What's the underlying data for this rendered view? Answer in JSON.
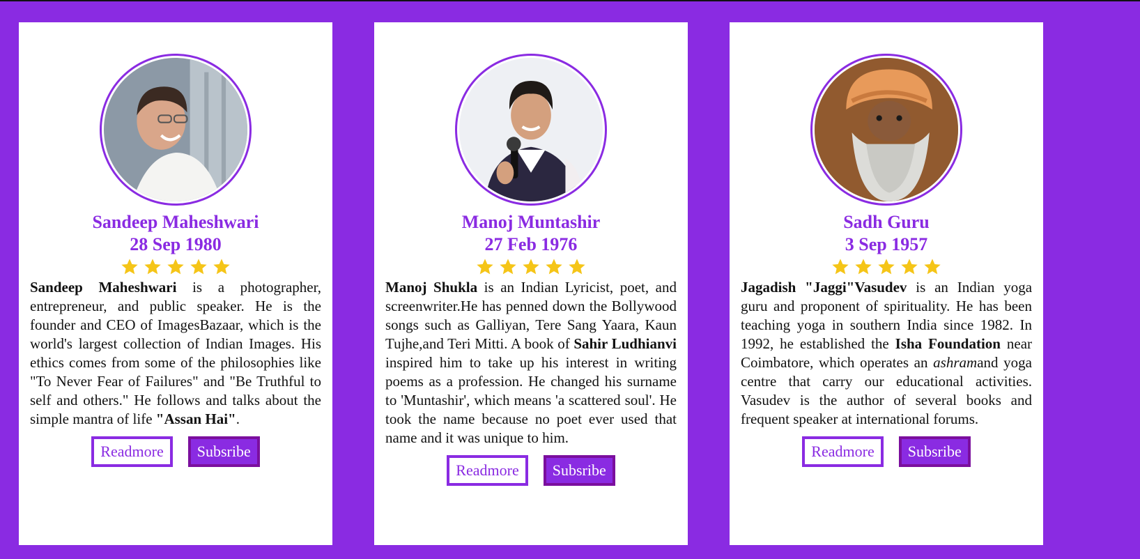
{
  "theme": {
    "accent": "#8a2be2",
    "star_color": "#f5c518",
    "card_bg": "#ffffff"
  },
  "cards": [
    {
      "photo_icon": "portrait-photo",
      "name": "Sandeep Maheshwari",
      "dob": "28 Sep 1980",
      "rating": 5,
      "bio": [
        {
          "t": "Sandeep Maheshwari",
          "b": true
        },
        {
          "t": " is a photographer, entrepreneur, and public speaker. He is the founder and CEO of ImagesBazaar, which is the world's largest collection of Indian Images. His ethics comes from some of the philosophies like \"To Never Fear of Failures\" and \"Be Truthful to self and others.\" He follows and talks about the simple mantra of life "
        },
        {
          "t": "\"Assan Hai\"",
          "b": true
        },
        {
          "t": "."
        }
      ],
      "readmore_label": "Readmore",
      "subscribe_label": "Subsribe"
    },
    {
      "photo_icon": "portrait-photo",
      "name": "Manoj Muntashir",
      "dob": "27 Feb 1976",
      "rating": 5,
      "bio": [
        {
          "t": "Manoj Shukla",
          "b": true
        },
        {
          "t": " is an Indian Lyricist, poet, and screenwriter.He has penned down the Bollywood songs such as Galliyan, Tere Sang Yaara, Kaun Tujhe,and Teri Mitti. A book of "
        },
        {
          "t": "Sahir Ludhianvi",
          "b": true
        },
        {
          "t": " inspired him to take up his interest in writing poems as a profession. He changed his surname to 'Muntashir', which means 'a scattered soul'. He took the name because no poet ever used that name and it was unique to him."
        }
      ],
      "readmore_label": "Readmore",
      "subscribe_label": "Subsribe"
    },
    {
      "photo_icon": "portrait-photo",
      "name": "Sadh Guru",
      "dob": "3 Sep 1957",
      "rating": 5,
      "bio": [
        {
          "t": "Jagadish \"Jaggi\"Vasudev",
          "b": true
        },
        {
          "t": " is an Indian yoga guru and proponent of spirituality. He has been teaching yoga in southern India since 1982. In 1992, he established the "
        },
        {
          "t": "Isha Foundation",
          "b": true
        },
        {
          "t": " near Coimbatore, which operates an "
        },
        {
          "t": "ashram",
          "i": true
        },
        {
          "t": "and yoga centre that carry our educational activities. Vasudev is the author of several books and frequent speaker at international forums."
        }
      ],
      "readmore_label": "Readmore",
      "subscribe_label": "Subsribe"
    }
  ]
}
